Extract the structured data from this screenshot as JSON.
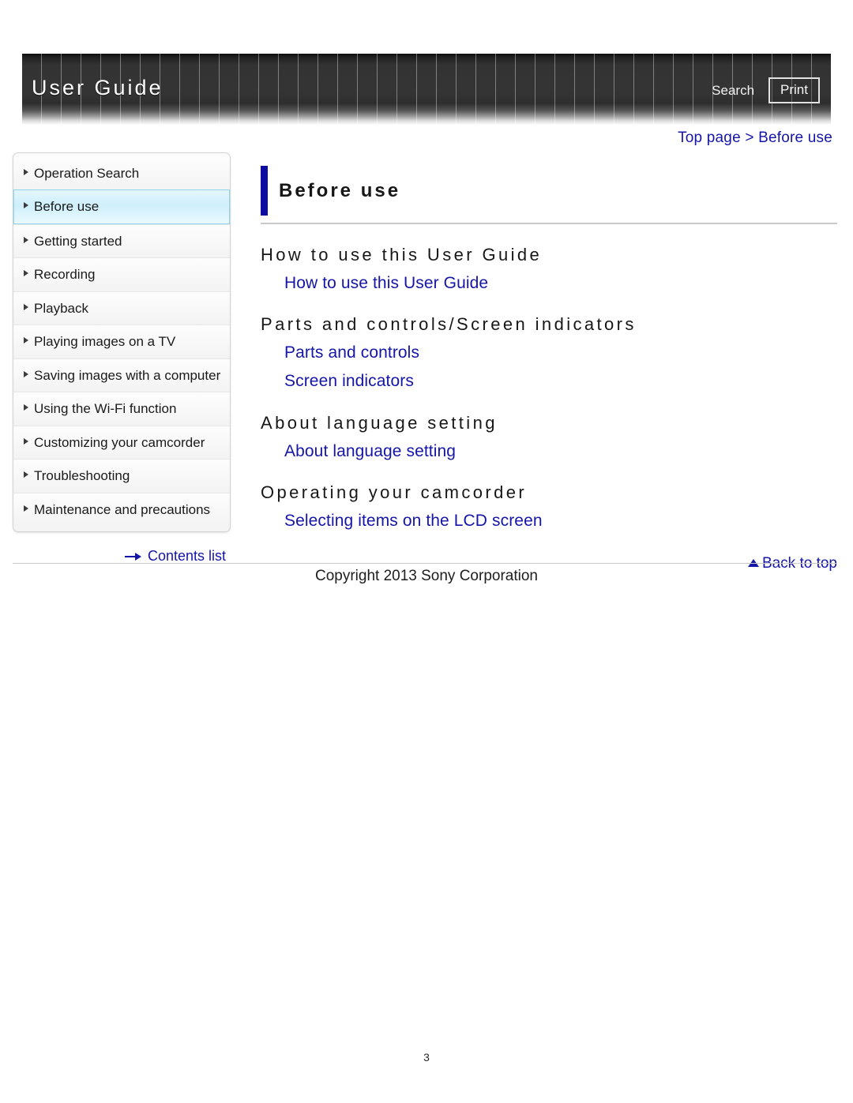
{
  "header": {
    "title": "User Guide",
    "search_label": "Search",
    "print_label": "Print"
  },
  "breadcrumb": {
    "text": "Top page > Before use"
  },
  "sidebar": {
    "items": [
      {
        "label": "Operation Search",
        "active": false
      },
      {
        "label": "Before use",
        "active": true
      },
      {
        "label": "Getting started",
        "active": false
      },
      {
        "label": "Recording",
        "active": false
      },
      {
        "label": "Playback",
        "active": false
      },
      {
        "label": "Playing images on a TV",
        "active": false
      },
      {
        "label": "Saving images with a computer",
        "active": false
      },
      {
        "label": "Using the Wi-Fi function",
        "active": false
      },
      {
        "label": "Customizing your camcorder",
        "active": false
      },
      {
        "label": "Troubleshooting",
        "active": false
      },
      {
        "label": "Maintenance and precautions",
        "active": false
      }
    ],
    "contents_list_label": "Contents list"
  },
  "main": {
    "page_title": "Before use",
    "sections": [
      {
        "heading": "How to use this User Guide",
        "links": [
          "How to use this User Guide"
        ]
      },
      {
        "heading": "Parts and controls/Screen indicators",
        "links": [
          "Parts and controls",
          "Screen indicators"
        ]
      },
      {
        "heading": "About language setting",
        "links": [
          "About language setting"
        ]
      },
      {
        "heading": "Operating your camcorder",
        "links": [
          "Selecting items on the LCD screen"
        ]
      }
    ],
    "back_to_top_label": "Back to top"
  },
  "footer": {
    "copyright": "Copyright 2013 Sony Corporation",
    "page_number": "3"
  },
  "colors": {
    "link": "#1515a8",
    "title_accent": "#0c0c9e",
    "header_bg": "#333333",
    "active_nav": "#cfeffb"
  }
}
